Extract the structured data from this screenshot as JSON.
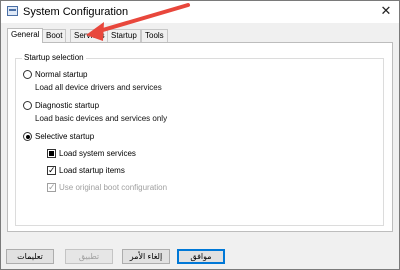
{
  "window": {
    "title": "System Configuration",
    "close_glyph": "✕"
  },
  "tabs": [
    {
      "label": "General",
      "active": true
    },
    {
      "label": "Boot"
    },
    {
      "label": "Services"
    },
    {
      "label": "Startup"
    },
    {
      "label": "Tools"
    }
  ],
  "startup": {
    "group_label": "Startup selection",
    "normal": {
      "label": "Normal startup",
      "description": "Load all device drivers and services",
      "selected": false
    },
    "diagnostic": {
      "label": "Diagnostic startup",
      "description": "Load basic devices and services only",
      "selected": false
    },
    "selective": {
      "label": "Selective startup",
      "selected": true
    },
    "options": {
      "load_system_services": {
        "label": "Load system services",
        "state": "indeterminate"
      },
      "load_startup_items": {
        "label": "Load startup items",
        "state": "checked"
      },
      "use_original_boot": {
        "label": "Use original boot configuration",
        "state": "checked-disabled"
      }
    }
  },
  "buttons": {
    "ok": "موافق",
    "cancel": "إلغاء الأمر",
    "apply": "تطبيق",
    "help": "تعليمات"
  },
  "annotation": {
    "arrow_color": "#e8473c"
  },
  "colors": {
    "accent": "#0078d7"
  }
}
